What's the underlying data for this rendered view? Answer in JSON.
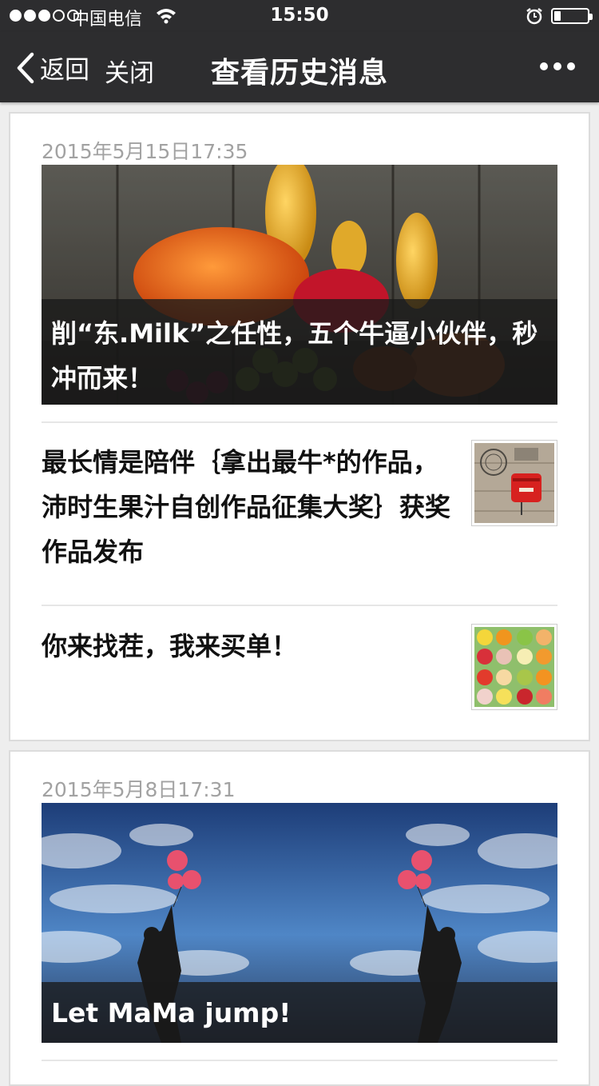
{
  "status_bar": {
    "carrier": "中国电信",
    "time": "15:50"
  },
  "nav": {
    "back_label": "返回",
    "close_label": "关闭",
    "title": "查看历史消息"
  },
  "groups": [
    {
      "date": "2015年5月15日17:35",
      "cover": {
        "caption": "削“东.Milk”之任性，五个牛逼小伙伴，秒冲而来！",
        "image": "pumpkins-and-fruit-photo"
      },
      "items": [
        {
          "title": "最长情是陪伴｛拿出最牛*的作品，沛时生果汁自创作品征集大奖｝获奖作品发布",
          "thumb": "red-mailbox-thumbnail"
        },
        {
          "title": "你来找茬，我来买单！",
          "thumb": "fruit-grid-thumbnail"
        }
      ]
    },
    {
      "date": "2015年5月8日17:31",
      "cover": {
        "caption": "Let MaMa jump!",
        "image": "balloon-jump-mirrored-photo"
      }
    }
  ]
}
